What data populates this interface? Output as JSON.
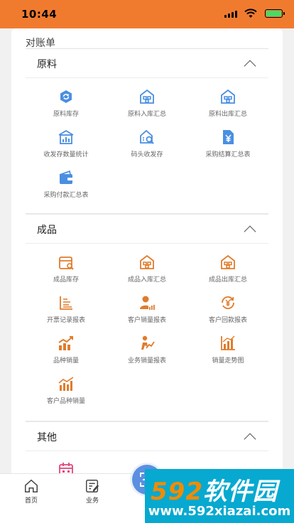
{
  "status": {
    "time": "10:44"
  },
  "page": {
    "title": "对账单"
  },
  "sections": [
    {
      "title": "原料",
      "color": "#4a8fe2",
      "items": [
        {
          "label": "原料库存",
          "icon": "cube-refresh-icon"
        },
        {
          "label": "原料入库汇总",
          "icon": "warehouse-icon"
        },
        {
          "label": "原料出库汇总",
          "icon": "warehouse-icon"
        },
        {
          "label": "收发存数量统计",
          "icon": "warehouse-chart-icon"
        },
        {
          "label": "码头收发存",
          "icon": "dock-search-icon"
        },
        {
          "label": "采购结算汇总表",
          "icon": "document-yen-icon"
        },
        {
          "label": "采购付款汇总表",
          "icon": "wallet-icon"
        }
      ]
    },
    {
      "title": "成品",
      "color": "#e07c2c",
      "items": [
        {
          "label": "成品库存",
          "icon": "box-search-icon"
        },
        {
          "label": "成品入库汇总",
          "icon": "warehouse-icon"
        },
        {
          "label": "成品出库汇总",
          "icon": "warehouse-icon"
        },
        {
          "label": "开票记录报表",
          "icon": "list-lines-icon"
        },
        {
          "label": "客户销量报表",
          "icon": "person-chart-icon"
        },
        {
          "label": "客户回款报表",
          "icon": "yen-cycle-icon"
        },
        {
          "label": "品种销量",
          "icon": "bar-trend-icon"
        },
        {
          "label": "业务销量报表",
          "icon": "person-trend-icon"
        },
        {
          "label": "销量走势图",
          "icon": "bar-chart-icon"
        },
        {
          "label": "客户品种销量",
          "icon": "bar-line-icon"
        }
      ]
    },
    {
      "title": "其他",
      "color": "#e0457b",
      "items": [
        {
          "label": "",
          "icon": "calendar-icon"
        }
      ]
    }
  ],
  "tabbar": {
    "home_label": "首页",
    "business_label": "业务"
  },
  "watermark": {
    "brand_num": "592",
    "brand_text": "软件园",
    "url": "www.592xiazai.com"
  }
}
